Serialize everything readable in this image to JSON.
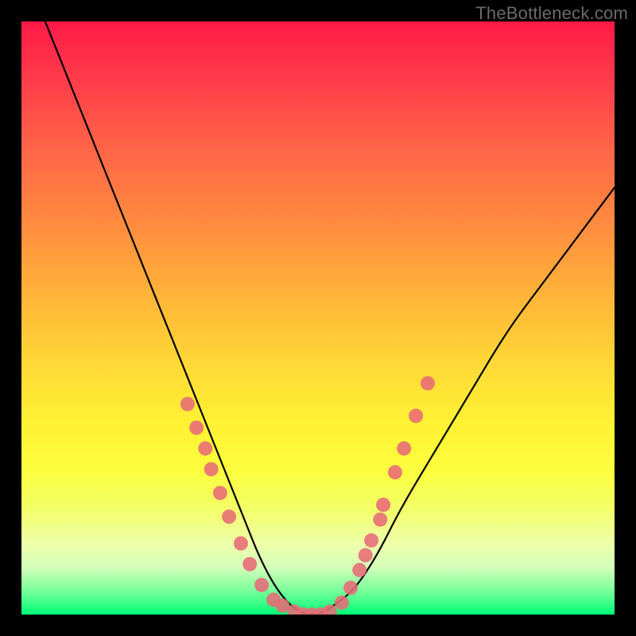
{
  "watermark": "TheBottleneck.com",
  "chart_data": {
    "type": "line",
    "title": "",
    "xlabel": "",
    "ylabel": "",
    "xlim": [
      0,
      100
    ],
    "ylim": [
      0,
      100
    ],
    "grid": false,
    "legend": false,
    "background": "rainbow-vertical",
    "series": [
      {
        "name": "bottleneck-curve",
        "x": [
          4,
          8,
          12,
          16,
          20,
          24,
          28,
          32,
          36,
          38,
          40,
          42,
          44,
          46,
          48,
          50,
          52,
          56,
          60,
          64,
          70,
          76,
          82,
          88,
          94,
          100
        ],
        "y": [
          100,
          90,
          80,
          70,
          60,
          50,
          40,
          30,
          20,
          15,
          10,
          6,
          3,
          1,
          0,
          0,
          1,
          4,
          10,
          18,
          28,
          38,
          48,
          56,
          64,
          72
        ]
      }
    ],
    "markers": {
      "left_cluster": [
        {
          "x": 28.0,
          "y": 35.5
        },
        {
          "x": 29.5,
          "y": 31.5
        },
        {
          "x": 31.0,
          "y": 28.0
        },
        {
          "x": 32.0,
          "y": 24.5
        },
        {
          "x": 33.5,
          "y": 20.5
        },
        {
          "x": 35.0,
          "y": 16.5
        },
        {
          "x": 37.0,
          "y": 12.0
        },
        {
          "x": 38.5,
          "y": 8.5
        },
        {
          "x": 40.5,
          "y": 5.0
        },
        {
          "x": 42.5,
          "y": 2.5
        },
        {
          "x": 44.0,
          "y": 1.5
        }
      ],
      "bottom_cluster": [
        {
          "x": 46.0,
          "y": 0.5
        },
        {
          "x": 47.5,
          "y": 0.0
        },
        {
          "x": 49.0,
          "y": 0.0
        },
        {
          "x": 50.5,
          "y": 0.0
        },
        {
          "x": 52.0,
          "y": 0.5
        }
      ],
      "right_cluster": [
        {
          "x": 54.0,
          "y": 2.0
        },
        {
          "x": 55.5,
          "y": 4.5
        },
        {
          "x": 57.0,
          "y": 7.5
        },
        {
          "x": 58.0,
          "y": 10.0
        },
        {
          "x": 59.0,
          "y": 12.5
        },
        {
          "x": 60.5,
          "y": 16.0
        },
        {
          "x": 61.0,
          "y": 18.5
        },
        {
          "x": 63.0,
          "y": 24.0
        },
        {
          "x": 64.5,
          "y": 28.0
        },
        {
          "x": 66.5,
          "y": 33.5
        },
        {
          "x": 68.5,
          "y": 39.0
        }
      ]
    }
  },
  "colors": {
    "marker": "#e86a77",
    "curve": "#000000"
  }
}
